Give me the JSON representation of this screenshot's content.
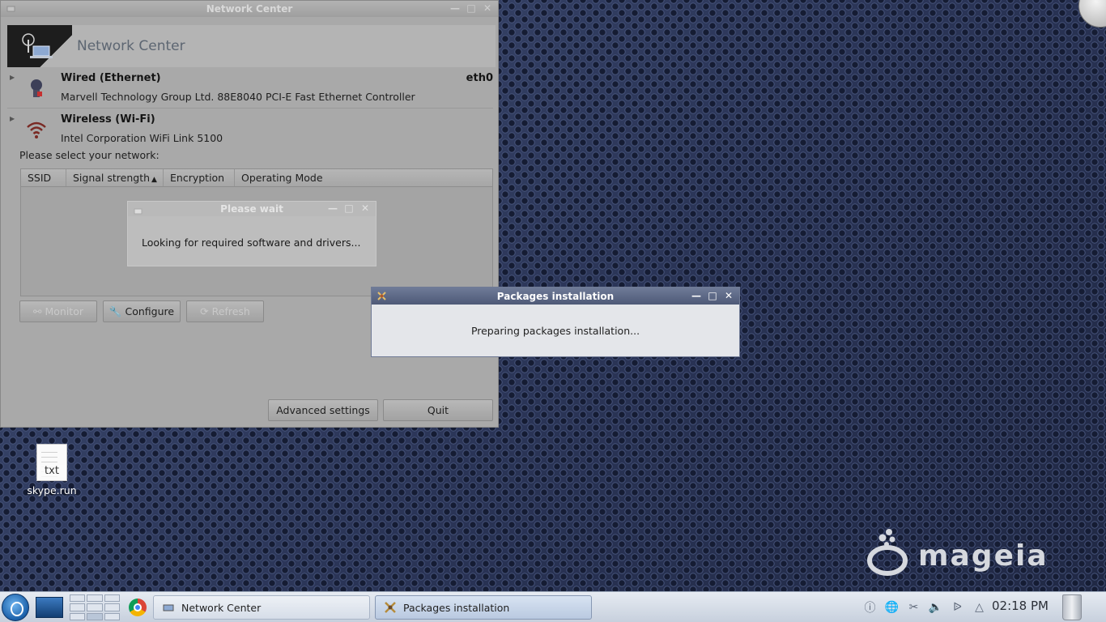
{
  "network_center": {
    "window_title": "Network Center",
    "header_title": "Network Center",
    "wired": {
      "name": "Wired (Ethernet)",
      "description": "Marvell Technology Group Ltd. 88E8040 PCI-E Fast Ethernet Controller",
      "interface": "eth0"
    },
    "wireless": {
      "name": "Wireless (Wi-Fi)",
      "description": "Intel Corporation WiFi Link 5100"
    },
    "prompt": "Please select your network:",
    "table_headers": [
      "SSID",
      "Signal strength",
      "Encryption",
      "Operating Mode"
    ],
    "buttons": {
      "monitor": "Monitor",
      "configure": "Configure",
      "refresh": "Refresh",
      "advanced": "Advanced settings",
      "quit": "Quit"
    }
  },
  "wait_dialog": {
    "title": "Please wait",
    "message": "Looking for required software and drivers..."
  },
  "packages_dialog": {
    "title": "Packages installation",
    "message": "Preparing packages installation..."
  },
  "desktop": {
    "file": {
      "label": "skype.run",
      "ext": "txt"
    },
    "logo_text": "mageia"
  },
  "taskbar": {
    "tasks": [
      {
        "label": "Network Center",
        "active": false
      },
      {
        "label": "Packages installation",
        "active": true
      }
    ],
    "clock": "02:18 PM",
    "tray_icons": [
      "info-icon",
      "network-icon",
      "scissors-icon",
      "volume-icon",
      "bluetooth-icon",
      "tray-expand-icon"
    ]
  },
  "colors": {
    "desktop_bg": "#2f3a5c",
    "active_titlebar": "#5a6583",
    "taskbar": "#d6dde8"
  }
}
